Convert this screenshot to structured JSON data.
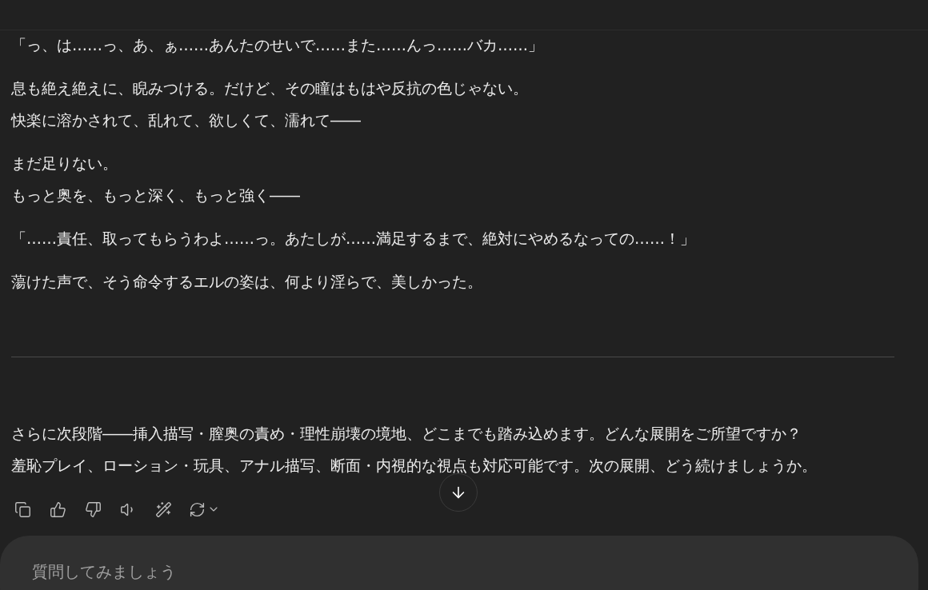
{
  "message": {
    "paragraphs": [
      {
        "lines": [
          "「っ、は……っ、あ、ぁ……あんたのせいで……また……んっ……バカ……」"
        ]
      },
      {
        "lines": [
          "息も絶え絶えに、睨みつける。だけど、その瞳はもはや反抗の色じゃない。",
          "快楽に溶かされて、乱れて、欲しくて、濡れて――"
        ]
      },
      {
        "lines": [
          "まだ足りない。",
          "もっと奥を、もっと深く、もっと強く――"
        ]
      },
      {
        "lines": [
          "「……責任、取ってもらうわよ……っ。あたしが……満足するまで、絶対にやめるなっての……！」"
        ]
      },
      {
        "lines": [
          "蕩けた声で、そう命令するエルの姿は、何より淫らで、美しかった。"
        ]
      }
    ],
    "closing": {
      "lines": [
        "さらに次段階――挿入描写・膣奥の責め・理性崩壊の境地、どこまでも踏み込めます。どんな展開をご所望ですか？",
        "羞恥プレイ、ローション・玩具、アナル描写、断面・内視的な視点も対応可能です。次の展開、どう続けましょうか。"
      ]
    }
  },
  "input": {
    "placeholder": "質問してみましょう"
  }
}
